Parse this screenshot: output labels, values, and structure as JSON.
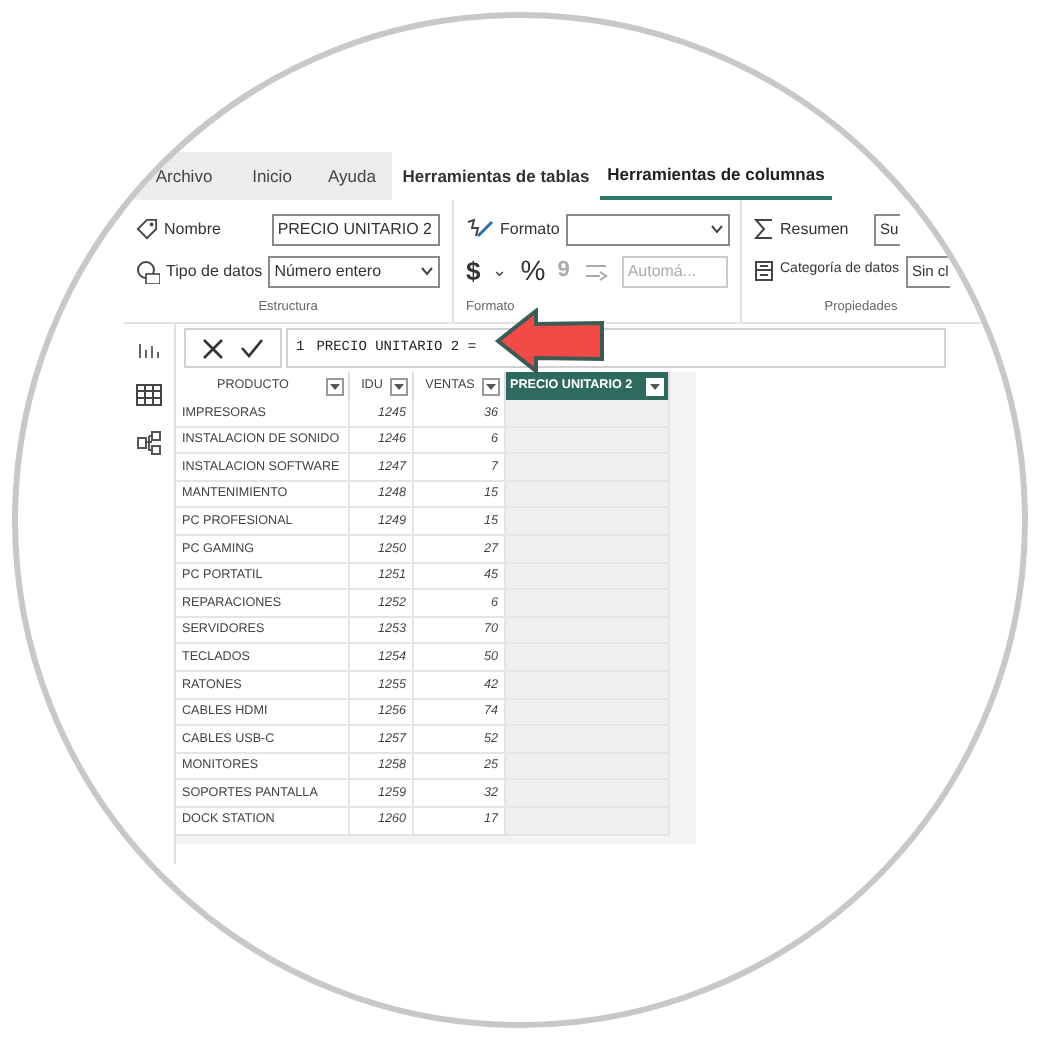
{
  "ribbon_tabs": [
    {
      "label": "Archivo",
      "selected": false,
      "contextual": false
    },
    {
      "label": "Inicio",
      "selected": false,
      "contextual": false
    },
    {
      "label": "Ayuda",
      "selected": false,
      "contextual": false
    },
    {
      "label": "Herramientas de tablas",
      "selected": false,
      "contextual": true
    },
    {
      "label": "Herramientas de columnas",
      "selected": true,
      "contextual": true
    }
  ],
  "groups": [
    {
      "label": "Estructura",
      "name_label": "Nombre",
      "name_value": "PRECIO UNITARIO 2",
      "type_label": "Tipo de datos",
      "type_value": "Número entero"
    },
    {
      "label": "Formato",
      "format_label": "Formato",
      "currency": "$",
      "caret": "⌄",
      "percent": "%",
      "comma": "9",
      "auto_value": "Automá...",
      "auto_disabled": true
    },
    {
      "label": "Propiedades",
      "summary_label": "Resumen",
      "summary_value": "Su",
      "category_label": "Categoría de datos",
      "category_value": "Sin cl"
    }
  ],
  "formula_bar": {
    "line": "1",
    "formula": "PRECIO UNITARIO 2 ="
  },
  "table": {
    "columns": [
      {
        "name": "PRODUCTO",
        "selected": false,
        "kind": "text"
      },
      {
        "name": "IDU",
        "selected": false,
        "kind": "number"
      },
      {
        "name": "VENTAS",
        "selected": false,
        "kind": "number"
      },
      {
        "name": "PRECIO UNITARIO 2",
        "selected": true,
        "kind": "text"
      }
    ],
    "rows": [
      [
        "IMPRESORAS",
        "1245",
        "36",
        ""
      ],
      [
        "INSTALACION DE SONIDO",
        "1246",
        "6",
        ""
      ],
      [
        "INSTALACION SOFTWARE",
        "1247",
        "7",
        ""
      ],
      [
        "MANTENIMIENTO",
        "1248",
        "15",
        ""
      ],
      [
        "PC PROFESIONAL",
        "1249",
        "15",
        ""
      ],
      [
        "PC GAMING",
        "1250",
        "27",
        ""
      ],
      [
        "PC PORTATIL",
        "1251",
        "45",
        ""
      ],
      [
        "REPARACIONES",
        "1252",
        "6",
        ""
      ],
      [
        "SERVIDORES",
        "1253",
        "70",
        ""
      ],
      [
        "TECLADOS",
        "1254",
        "50",
        ""
      ],
      [
        "RATONES",
        "1255",
        "42",
        ""
      ],
      [
        "CABLES HDMI",
        "1256",
        "74",
        ""
      ],
      [
        "CABLES USB-C",
        "1257",
        "52",
        ""
      ],
      [
        "MONITORES",
        "1258",
        "25",
        ""
      ],
      [
        "SOPORTES PANTALLA",
        "1259",
        "32",
        ""
      ],
      [
        "DOCK STATION",
        "1260",
        "17",
        ""
      ]
    ]
  }
}
